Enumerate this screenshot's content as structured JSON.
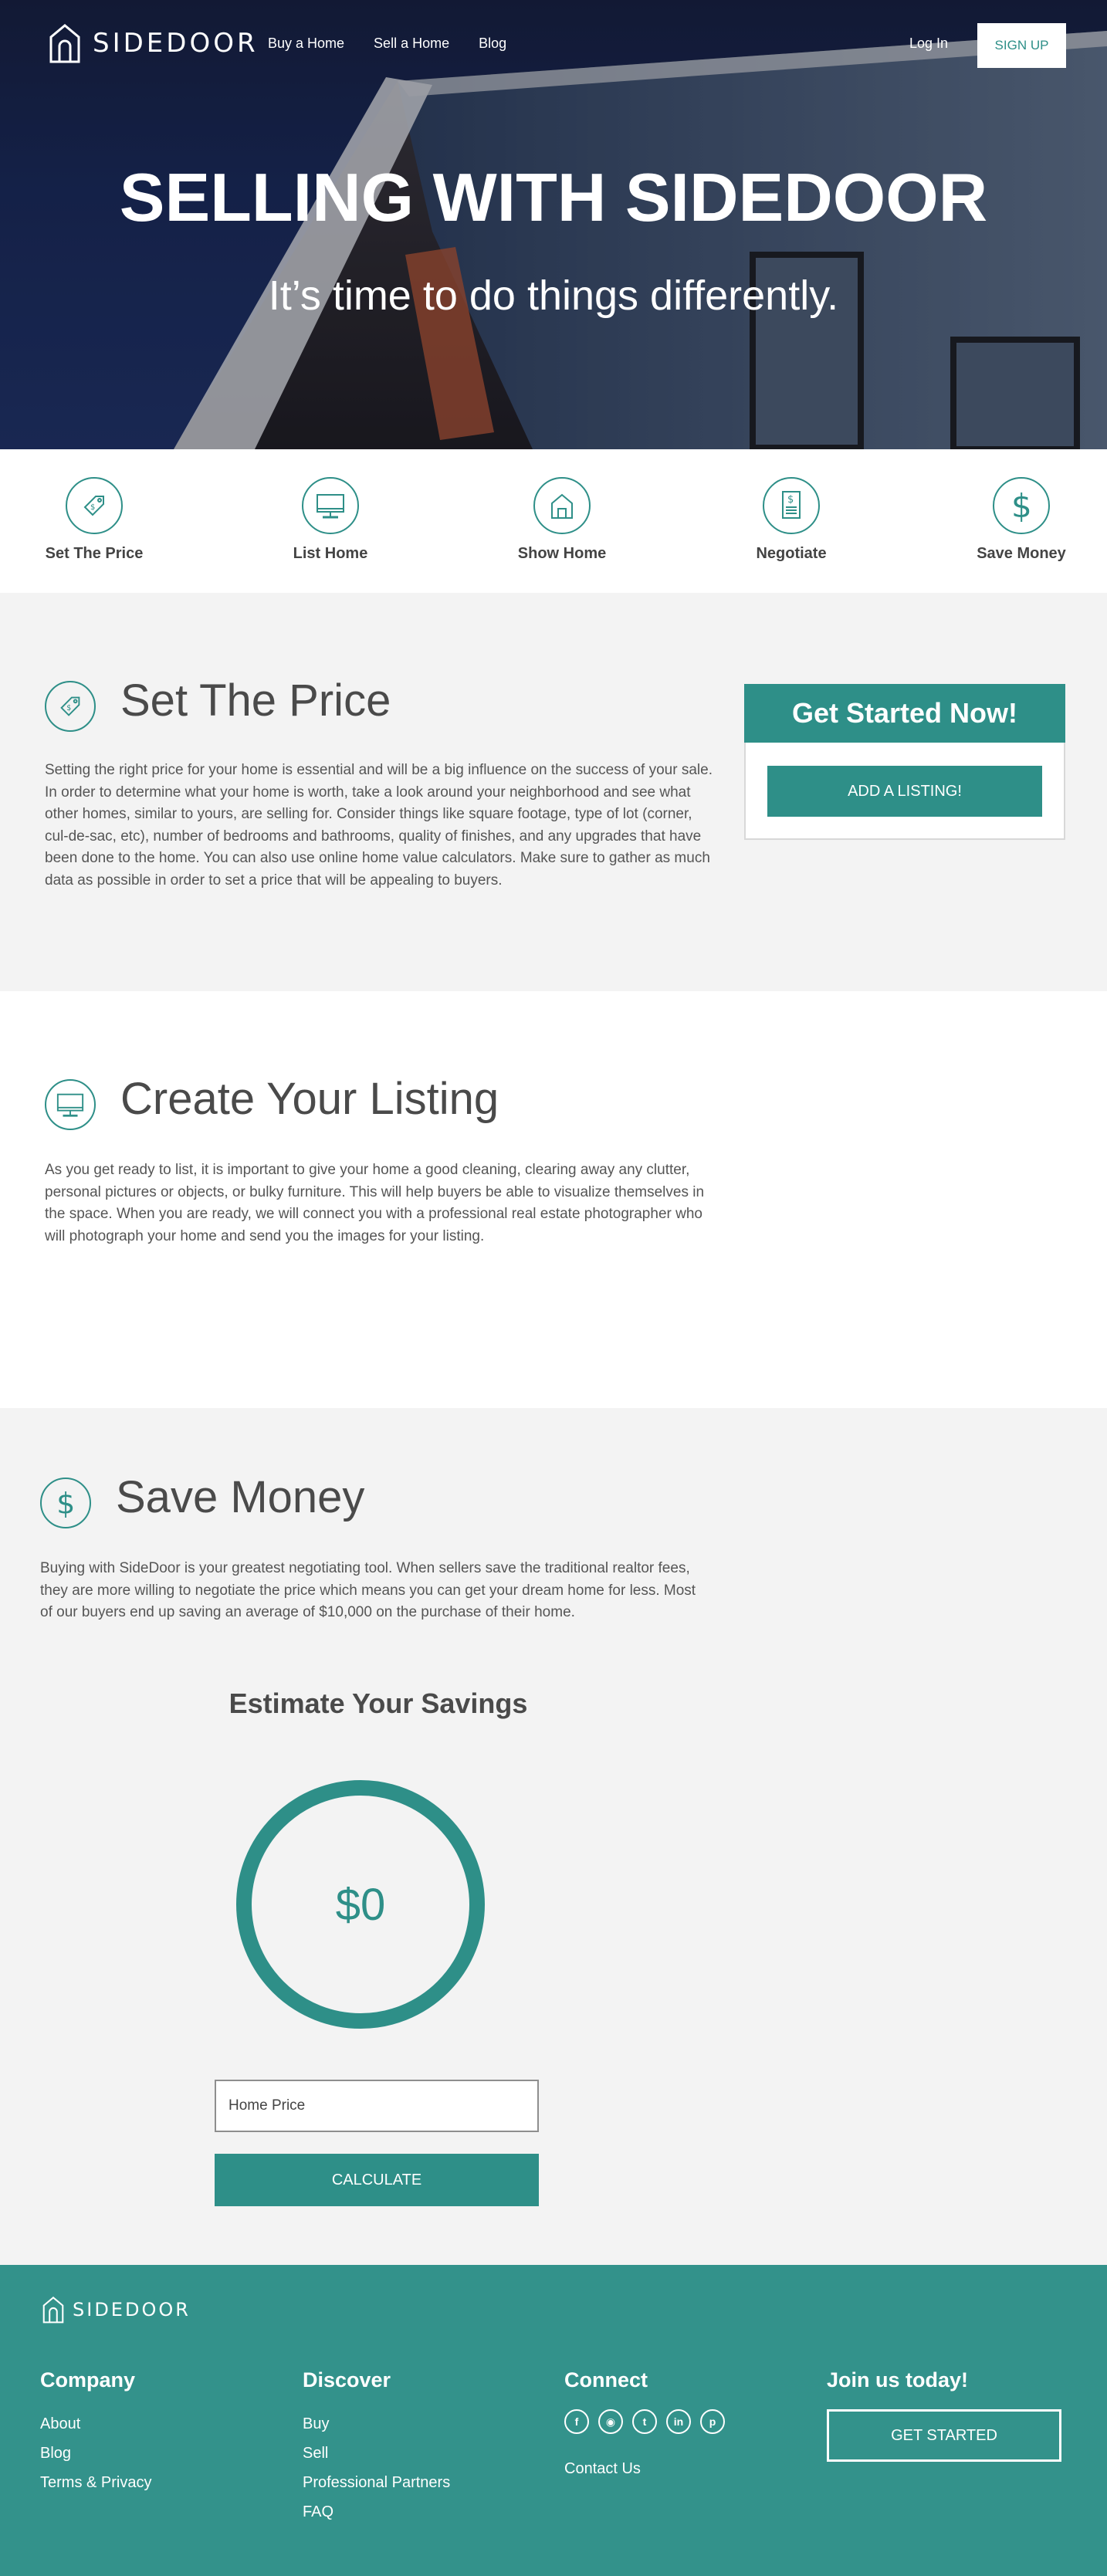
{
  "brand": {
    "name": "SIDEDOOR"
  },
  "nav": {
    "links": [
      "Buy a Home",
      "Sell a Home",
      "Blog"
    ],
    "login": "Log In",
    "signup": "SIGN UP"
  },
  "hero": {
    "title": "SELLING WITH SIDEDOOR",
    "subtitle": "It’s time to do things differently."
  },
  "steps": [
    {
      "label": "Set The Price",
      "icon": "price-tag-icon"
    },
    {
      "label": "List Home",
      "icon": "monitor-icon"
    },
    {
      "label": "Show Home",
      "icon": "house-icon"
    },
    {
      "label": "Negotiate",
      "icon": "document-dollar-icon"
    },
    {
      "label": "Save Money",
      "icon": "dollar-icon"
    }
  ],
  "set_price": {
    "title": "Set The Price",
    "body": "Setting the right price for your home is essential and will be a big influence on the success of your sale. In order to determine what your home is worth, take a look around your neighborhood and see what other homes, similar to yours, are selling for. Consider things like square footage, type of lot (corner, cul-de-sac, etc), number of bedrooms and bathrooms, quality of finishes, and any upgrades that have been done to the home. You can also use online home value calculators. Make sure to gather as much data as possible in order to set a price that will be appealing to buyers."
  },
  "cta": {
    "title": "Get Started Now!",
    "button": "ADD A LISTING!"
  },
  "create_listing": {
    "title": "Create Your Listing",
    "body": "As you get ready to list, it is important to give your home a good cleaning, clearing away any clutter, personal pictures or objects, or bulky furniture. This will help buyers be able to visualize themselves in the space. When you are ready, we will connect you with a professional real estate photographer who will photograph your home and send you the images for your listing."
  },
  "save_money": {
    "title": "Save Money",
    "body": "Buying with SideDoor is your greatest negotiating tool. When sellers save the traditional realtor fees, they are more willing to negotiate the price which means you can get your dream home for less. Most of our buyers end up saving an average of $10,000 on the purchase of their home."
  },
  "estimator": {
    "title": "Estimate Your Savings",
    "amount": "$0",
    "placeholder": "Home Price",
    "button": "CALCULATE"
  },
  "footer": {
    "brand": "SIDEDOOR",
    "company": {
      "heading": "Company",
      "links": [
        "About",
        "Blog",
        "Terms & Privacy"
      ]
    },
    "discover": {
      "heading": "Discover",
      "links": [
        "Buy",
        "Sell",
        "Professional Partners",
        "FAQ"
      ]
    },
    "connect": {
      "heading": "Connect",
      "social": [
        "facebook-icon",
        "instagram-icon",
        "twitter-icon",
        "linkedin-icon",
        "pinterest-icon"
      ],
      "contact": "Contact Us"
    },
    "join": {
      "heading": "Join us today!",
      "button": "GET STARTED"
    }
  },
  "colors": {
    "accent": "#2e8f88",
    "footer": "#33928b",
    "hero_dark": "#131a36"
  }
}
